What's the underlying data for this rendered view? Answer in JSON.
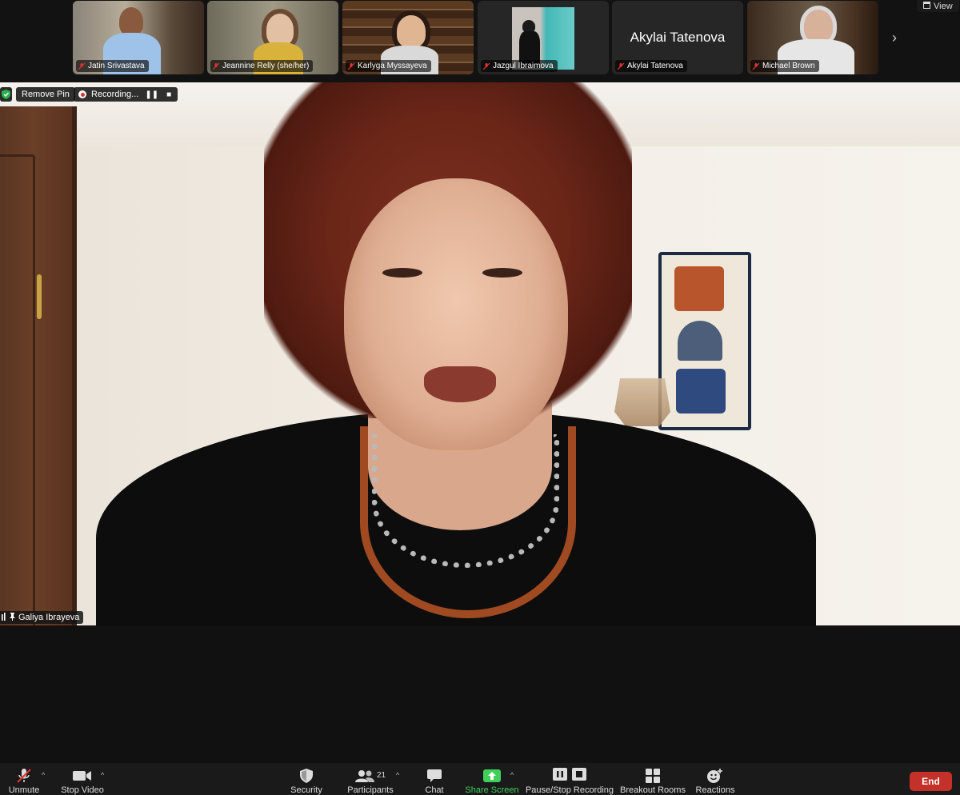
{
  "top_strip": {
    "participants": [
      {
        "name": "Jatin Srivastava",
        "video": true
      },
      {
        "name": "Jeannine Relly (she/her)",
        "video": true
      },
      {
        "name": "Karlyga Myssayeva",
        "video": true
      },
      {
        "name": "Jazgul Ibraimova",
        "video": true
      },
      {
        "name": "Akylai Tatenova",
        "video": false,
        "big_name": "Akylai Tatenova"
      },
      {
        "name": "Michael Brown",
        "video": true
      }
    ],
    "view_label": "View"
  },
  "main_video": {
    "remove_pin_label": "Remove Pin",
    "recording_label": "Recording...",
    "speaker_name": "Galiya Ibrayeva"
  },
  "toolbar": {
    "unmute_label": "Unmute",
    "stop_video_label": "Stop Video",
    "security_label": "Security",
    "participants_label": "Participants",
    "participants_count": "21",
    "chat_label": "Chat",
    "share_screen_label": "Share Screen",
    "recording_label": "Pause/Stop Recording",
    "breakout_label": "Breakout Rooms",
    "reactions_label": "Reactions",
    "end_label": "End"
  },
  "colors": {
    "end_red": "#c4312b",
    "share_green": "#3fcf5a",
    "mic_muted_red": "#e0332e"
  }
}
